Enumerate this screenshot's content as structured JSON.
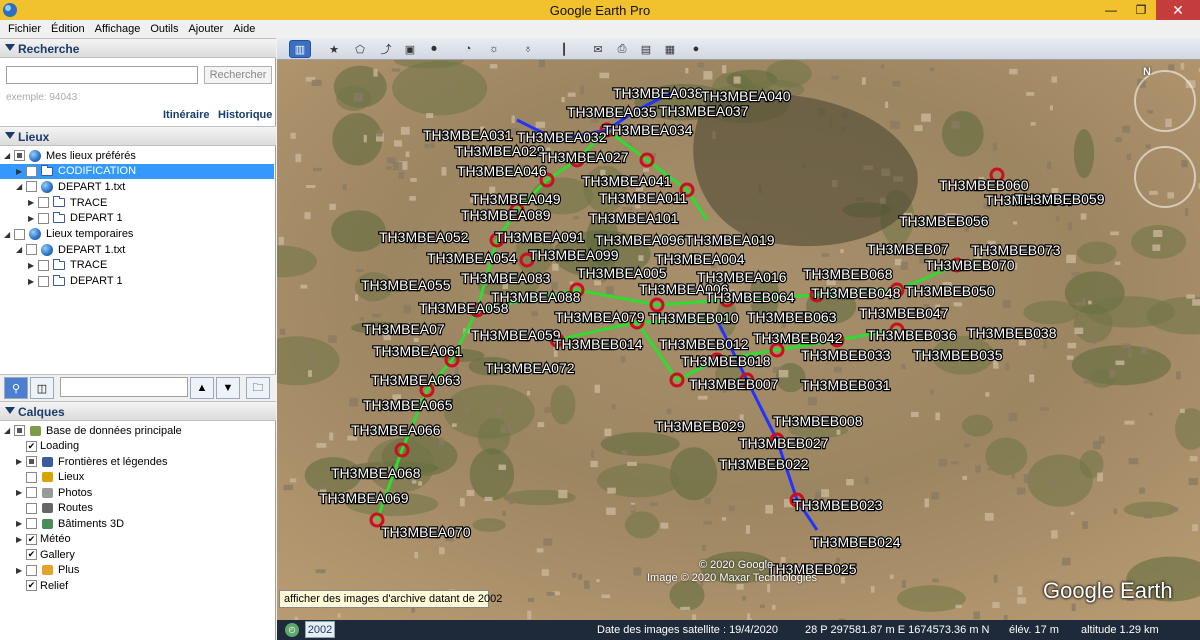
{
  "window": {
    "title": "Google Earth Pro"
  },
  "menu": [
    "Fichier",
    "Édition",
    "Affichage",
    "Outils",
    "Ajouter",
    "Aide"
  ],
  "search": {
    "header": "Recherche",
    "placeholder": "",
    "button": "Rechercher",
    "hint": "exemple: 94043",
    "link_itinerary": "Itinéraire",
    "link_history": "Historique"
  },
  "places": {
    "header": "Lieux",
    "items": [
      {
        "label": "Mes lieux préférés",
        "depth": 0,
        "icon": "globe-icon",
        "check": "partial",
        "expand": "open",
        "selected": false
      },
      {
        "label": "CODIFICATION",
        "depth": 1,
        "icon": "folder-icon",
        "check": "checked",
        "expand": "closed",
        "selected": true
      },
      {
        "label": "DEPART 1.txt",
        "depth": 1,
        "icon": "globe-icon",
        "check": "empty",
        "expand": "open",
        "selected": false
      },
      {
        "label": "TRACE",
        "depth": 2,
        "icon": "folder-icon",
        "check": "empty",
        "expand": "closed",
        "selected": false
      },
      {
        "label": "DEPART 1",
        "depth": 2,
        "icon": "folder-icon",
        "check": "empty",
        "expand": "closed",
        "selected": false
      },
      {
        "label": "Lieux temporaires",
        "depth": 0,
        "icon": "globe-icon",
        "check": "empty",
        "expand": "open",
        "selected": false
      },
      {
        "label": "DEPART 1.txt",
        "depth": 1,
        "icon": "globe-icon",
        "check": "empty",
        "expand": "open",
        "selected": false
      },
      {
        "label": "TRACE",
        "depth": 2,
        "icon": "folder-icon",
        "check": "empty",
        "expand": "closed",
        "selected": false
      },
      {
        "label": "DEPART 1",
        "depth": 2,
        "icon": "folder-icon",
        "check": "empty",
        "expand": "closed",
        "selected": false
      }
    ]
  },
  "layers": {
    "header": "Calques",
    "items": [
      {
        "label": "Base de données principale",
        "depth": 0,
        "icon": "layers-icon",
        "check": "partial",
        "expand": "open"
      },
      {
        "label": "Loading",
        "depth": 1,
        "icon": "",
        "check": "checked",
        "expand": ""
      },
      {
        "label": "Frontières et légendes",
        "depth": 1,
        "icon": "flag-icon",
        "check": "partial",
        "expand": "closed"
      },
      {
        "label": "Lieux",
        "depth": 1,
        "icon": "places-icon",
        "check": "empty",
        "expand": ""
      },
      {
        "label": "Photos",
        "depth": 1,
        "icon": "photo-icon",
        "check": "empty",
        "expand": "closed"
      },
      {
        "label": "Routes",
        "depth": 1,
        "icon": "road-icon",
        "check": "empty",
        "expand": ""
      },
      {
        "label": "Bâtiments 3D",
        "depth": 1,
        "icon": "building-icon",
        "check": "empty",
        "expand": "closed"
      },
      {
        "label": "Météo",
        "depth": 1,
        "icon": "",
        "check": "checked",
        "expand": "closed"
      },
      {
        "label": "Gallery",
        "depth": 1,
        "icon": "",
        "check": "checked",
        "expand": ""
      },
      {
        "label": "Plus",
        "depth": 1,
        "icon": "more-icon",
        "check": "empty",
        "expand": "closed"
      },
      {
        "label": "Relief",
        "depth": 1,
        "icon": "",
        "check": "checked",
        "expand": ""
      }
    ]
  },
  "toolbar": {
    "buttons": [
      "sidebar-toggle-icon",
      "placemark-icon",
      "polygon-icon",
      "path-icon",
      "image-overlay-icon",
      "record-tour-icon",
      "historical-imagery-icon",
      "sunlight-icon",
      "planets-icon",
      "ruler-icon",
      "email-icon",
      "print-icon",
      "save-image-icon",
      "maps-icon",
      "earth-gallery-icon"
    ]
  },
  "map": {
    "tooltip": "afficher des images d'archive datant de 2002",
    "copyright_1": "© 2020 Google",
    "copyright_2": "Image © 2020 Maxar Technologies",
    "brand": "Google Earth",
    "north": "N",
    "labels": [
      {
        "t": "TH3MBEA038"
      },
      {
        "t": "TH3MBEA040"
      },
      {
        "t": "TH3MBEA035"
      },
      {
        "t": "TH3MBEA037"
      },
      {
        "t": "TH3MBEA034"
      },
      {
        "t": "TH3MBEA031"
      },
      {
        "t": "TH3MBEA032"
      },
      {
        "t": "TH3MBEA029"
      },
      {
        "t": "TH3MBEA027"
      },
      {
        "t": "TH3MBEA046"
      },
      {
        "t": "TH3MBEA041"
      },
      {
        "t": "TH3MBEA049"
      },
      {
        "t": "TH3MBEA011"
      },
      {
        "t": "TH3MBEA089"
      },
      {
        "t": "TH3MBEA101"
      },
      {
        "t": "TH3MBEA052"
      },
      {
        "t": "TH3MBEA091"
      },
      {
        "t": "TH3MBEA096"
      },
      {
        "t": "TH3MBEA019"
      },
      {
        "t": "TH3MBEA054"
      },
      {
        "t": "TH3MBEA099"
      },
      {
        "t": "TH3MBEA004"
      },
      {
        "t": "TH3MBEA083"
      },
      {
        "t": "TH3MBEA005"
      },
      {
        "t": "TH3MBEA016"
      },
      {
        "t": "TH3MBEA055"
      },
      {
        "t": "TH3MBEA006"
      },
      {
        "t": "TH3MBEA088"
      },
      {
        "t": "TH3MBEA058"
      },
      {
        "t": "TH3MBEA079"
      },
      {
        "t": "TH3MBEB010"
      },
      {
        "t": "TH3MBEA07"
      },
      {
        "t": "TH3MBEA059"
      },
      {
        "t": "TH3MBEB014"
      },
      {
        "t": "TH3MBEB012"
      },
      {
        "t": "TH3MBEA061"
      },
      {
        "t": "TH3MBEA072"
      },
      {
        "t": "TH3MBEA063"
      },
      {
        "t": "TH3MBEA065"
      },
      {
        "t": "TH3MBEA066"
      },
      {
        "t": "TH3MBEA068"
      },
      {
        "t": "TH3MBEA069"
      },
      {
        "t": "TH3MBEA070"
      },
      {
        "t": "TH3MBEB060"
      },
      {
        "t": "TH3MBEB057"
      },
      {
        "t": "TH3MBEB059"
      },
      {
        "t": "TH3MBEB056"
      },
      {
        "t": "TH3MBEB07"
      },
      {
        "t": "TH3MBEB073"
      },
      {
        "t": "TH3MBEB068"
      },
      {
        "t": "TH3MBEB070"
      },
      {
        "t": "TH3MBEB064"
      },
      {
        "t": "TH3MBEB048"
      },
      {
        "t": "TH3MBEB050"
      },
      {
        "t": "TH3MBEB063"
      },
      {
        "t": "TH3MBEB047"
      },
      {
        "t": "TH3MBEB042"
      },
      {
        "t": "TH3MBEB036"
      },
      {
        "t": "TH3MBEB038"
      },
      {
        "t": "TH3MBEB018"
      },
      {
        "t": "TH3MBEB033"
      },
      {
        "t": "TH3MBEB035"
      },
      {
        "t": "TH3MBEB007"
      },
      {
        "t": "TH3MBEB031"
      },
      {
        "t": "TH3MBEB029"
      },
      {
        "t": "TH3MBEB008"
      },
      {
        "t": "TH3MBEB027"
      },
      {
        "t": "TH3MBEB022"
      },
      {
        "t": "TH3MBEB023"
      },
      {
        "t": "TH3MBEB024"
      },
      {
        "t": "TH3MBEB025"
      }
    ]
  },
  "status": {
    "year": "2002",
    "imagery_date": "Date des images satellite : 19/4/2020",
    "coords": "28 P 297581.87 m E 1674573.36 m N",
    "elev": "élév.   17 m",
    "altitude": "altitude   1.29 km"
  },
  "colors": {
    "accent": "#3399ff",
    "titlebar": "#f2c12e",
    "line_green": "#2fdc2f",
    "line_blue": "#2233ff",
    "marker_red": "#c8101e"
  }
}
